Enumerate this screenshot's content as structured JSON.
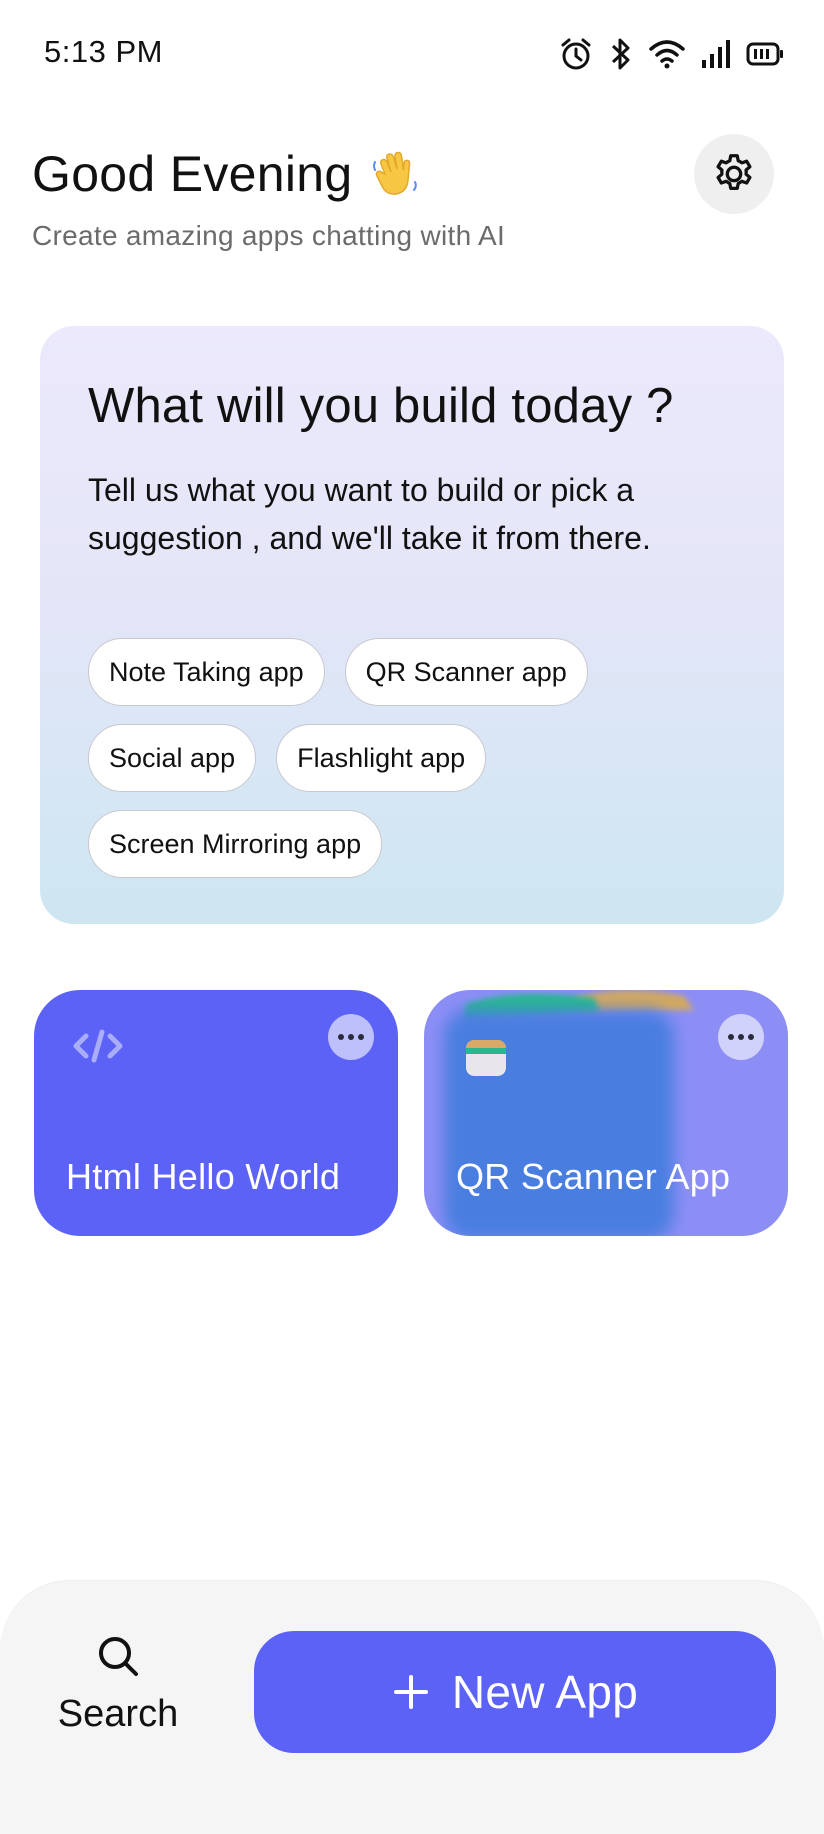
{
  "status_bar": {
    "time": "5:13 PM",
    "icons": [
      "alarm-icon",
      "bluetooth-icon",
      "wifi-icon",
      "signal-icon",
      "battery-icon"
    ]
  },
  "header": {
    "greeting": "Good Evening",
    "greeting_emoji": "waving-hand-icon",
    "subtitle": "Create amazing apps chatting with AI",
    "settings_icon": "gear-icon"
  },
  "hero": {
    "title": "What will you build today ?",
    "description": "Tell us what you want to build or pick a suggestion , and we'll take it from there.",
    "suggestions": [
      {
        "label": "Note Taking app"
      },
      {
        "label": "QR Scanner app"
      },
      {
        "label": "Social app"
      },
      {
        "label": "Flashlight app"
      },
      {
        "label": "Screen Mirroring app"
      }
    ]
  },
  "projects": [
    {
      "title": "Html Hello World",
      "icon": "code-icon",
      "color": "#5b62f5"
    },
    {
      "title": "QR Scanner App",
      "icon": "app-thumbnail-icon",
      "color": "#8c8ef5"
    }
  ],
  "bottom_bar": {
    "search_label": "Search",
    "new_app_label": "New App"
  },
  "colors": {
    "accent": "#5b62f5",
    "hero_gradient_top": "#ebe9fb",
    "hero_gradient_bottom": "#cde6f2"
  }
}
